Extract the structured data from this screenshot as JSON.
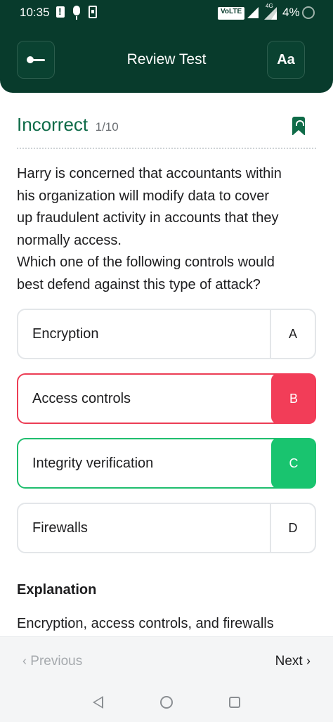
{
  "status_bar": {
    "time": "10:35",
    "volte": "VoLTE",
    "network": "4G",
    "battery": "4%"
  },
  "header": {
    "title": "Review Test",
    "font_button_label": "Aa"
  },
  "result": {
    "label": "Incorrect",
    "count": "1/10"
  },
  "question": "Harry is concerned that accountants within\nhis organization will modify data to cover\nup fraudulent activity in accounts that they\nnormally access.\nWhich one of the following controls would\nbest defend against this type of attack?",
  "options": [
    {
      "text": "Encryption",
      "letter": "A",
      "state": "neutral"
    },
    {
      "text": "Access controls",
      "letter": "B",
      "state": "wrong"
    },
    {
      "text": "Integrity verification",
      "letter": "C",
      "state": "correct"
    },
    {
      "text": "Firewalls",
      "letter": "D",
      "state": "neutral"
    }
  ],
  "explanation": {
    "title": "Explanation",
    "body": "Encryption, access controls, and firewalls"
  },
  "footer": {
    "previous_label": "Previous",
    "next_label": "Next"
  },
  "colors": {
    "header_bg": "#083b2c",
    "result_green": "#0e6b48",
    "wrong": "#f23d58",
    "correct": "#19c46f"
  }
}
